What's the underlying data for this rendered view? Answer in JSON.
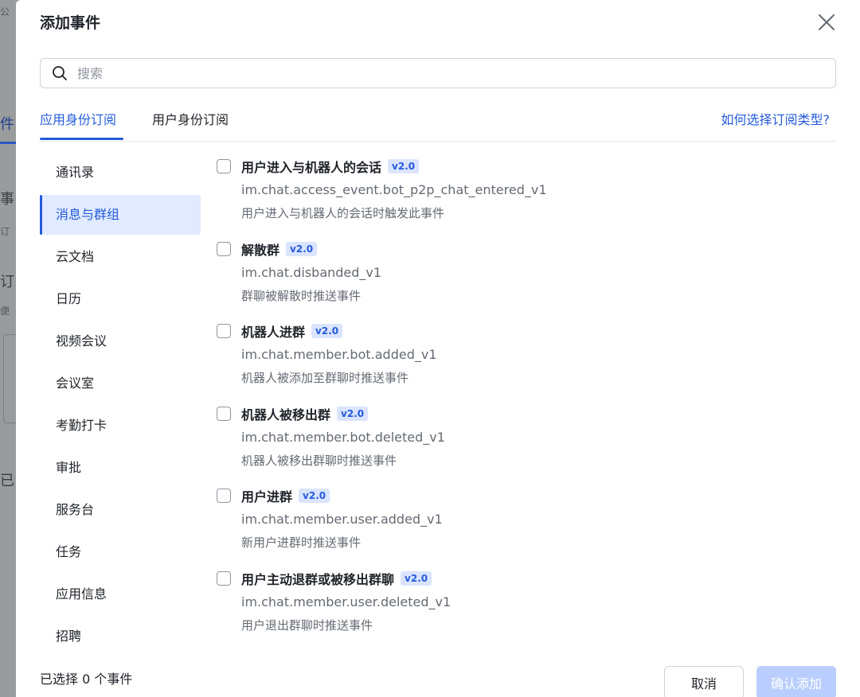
{
  "background": {
    "fragments": [
      "公",
      "件",
      "事",
      "订",
      "订",
      "便",
      "已"
    ]
  },
  "dialog": {
    "title": "添加事件",
    "search": {
      "placeholder": "搜索",
      "value": ""
    },
    "tabs": [
      {
        "label": "应用身份订阅",
        "active": true
      },
      {
        "label": "用户身份订阅",
        "active": false
      }
    ],
    "help_link": "如何选择订阅类型?",
    "categories": [
      {
        "label": "通讯录",
        "active": false
      },
      {
        "label": "消息与群组",
        "active": true
      },
      {
        "label": "云文档",
        "active": false
      },
      {
        "label": "日历",
        "active": false
      },
      {
        "label": "视频会议",
        "active": false
      },
      {
        "label": "会议室",
        "active": false
      },
      {
        "label": "考勤打卡",
        "active": false
      },
      {
        "label": "审批",
        "active": false
      },
      {
        "label": "服务台",
        "active": false
      },
      {
        "label": "任务",
        "active": false
      },
      {
        "label": "应用信息",
        "active": false
      },
      {
        "label": "招聘",
        "active": false
      }
    ],
    "events": [
      {
        "name": "用户进入与机器人的会话",
        "version": "v2.0",
        "code": "im.chat.access_event.bot_p2p_chat_entered_v1",
        "description": "用户进入与机器人的会话时触发此事件",
        "checked": false
      },
      {
        "name": "解散群",
        "version": "v2.0",
        "code": "im.chat.disbanded_v1",
        "description": "群聊被解散时推送事件",
        "checked": false
      },
      {
        "name": "机器人进群",
        "version": "v2.0",
        "code": "im.chat.member.bot.added_v1",
        "description": "机器人被添加至群聊时推送事件",
        "checked": false
      },
      {
        "name": "机器人被移出群",
        "version": "v2.0",
        "code": "im.chat.member.bot.deleted_v1",
        "description": "机器人被移出群聊时推送事件",
        "checked": false
      },
      {
        "name": "用户进群",
        "version": "v2.0",
        "code": "im.chat.member.user.added_v1",
        "description": "新用户进群时推送事件",
        "checked": false
      },
      {
        "name": "用户主动退群或被移出群聊",
        "version": "v2.0",
        "code": "im.chat.member.user.deleted_v1",
        "description": "用户退出群聊时推送事件",
        "checked": false
      }
    ],
    "footer": {
      "selected_count": "已选择 0 个事件",
      "cancel_label": "取消",
      "confirm_label": "确认添加"
    }
  },
  "colors": {
    "accent": "#245bdb",
    "active_bg": "#e1eaff",
    "badge_bg": "#dbe4ff",
    "confirm_disabled": "#bacefd"
  },
  "icons": {
    "close": "close-icon",
    "search": "search-icon"
  }
}
